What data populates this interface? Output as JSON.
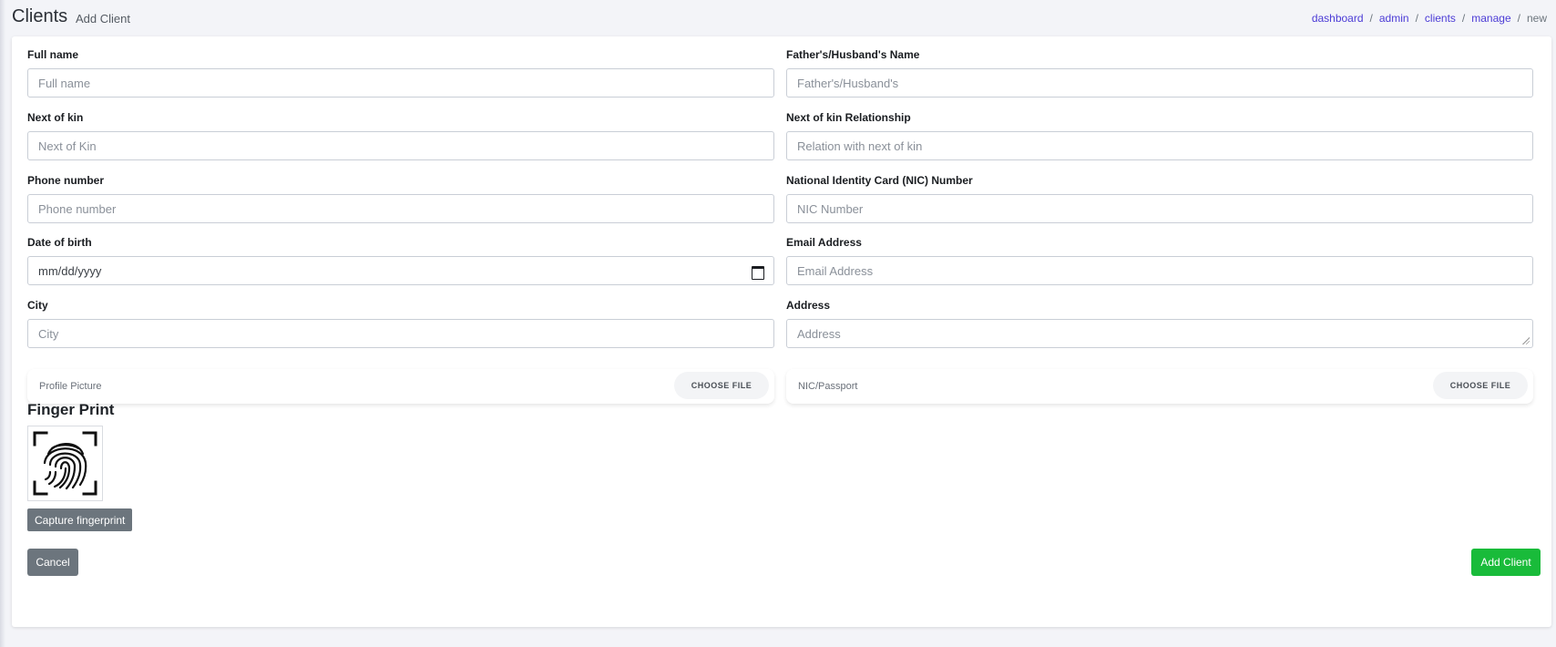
{
  "header": {
    "title": "Clients",
    "subtitle": "Add Client",
    "breadcrumb": {
      "links": [
        "dashboard",
        "admin",
        "clients",
        "manage"
      ],
      "separator": "/",
      "current": "new"
    }
  },
  "form": {
    "full_name": {
      "label": "Full name",
      "placeholder": "Full name"
    },
    "guardian_name": {
      "label": "Father's/Husband's Name",
      "placeholder": "Father's/Husband's"
    },
    "next_of_kin": {
      "label": "Next of kin",
      "placeholder": "Next of Kin"
    },
    "kin_relationship": {
      "label": "Next of kin Relationship",
      "placeholder": "Relation with next of kin"
    },
    "phone": {
      "label": "Phone number",
      "placeholder": "Phone number"
    },
    "nic": {
      "label": "National Identity Card (NIC) Number",
      "placeholder": "NIC Number"
    },
    "dob": {
      "label": "Date of birth",
      "value": "mm/dd/yyyy"
    },
    "email": {
      "label": "Email Address",
      "placeholder": "Email Address"
    },
    "city": {
      "label": "City",
      "placeholder": "City"
    },
    "address": {
      "label": "Address",
      "placeholder": "Address"
    },
    "profile_picture": {
      "label": "Profile Picture",
      "button": "CHOOSE FILE"
    },
    "nic_passport": {
      "label": "NIC/Passport",
      "button": "CHOOSE FILE"
    }
  },
  "fingerprint": {
    "title": "Finger Print",
    "icon": "fingerprint-icon",
    "capture_label": "Capture fingerprint"
  },
  "actions": {
    "cancel_label": "Cancel",
    "submit_label": "Add Client"
  },
  "colors": {
    "link": "#4b3bd6",
    "secondary_button": "#6c757d",
    "submit_button": "#19bb3a",
    "page_background": "#f3f4f8"
  }
}
